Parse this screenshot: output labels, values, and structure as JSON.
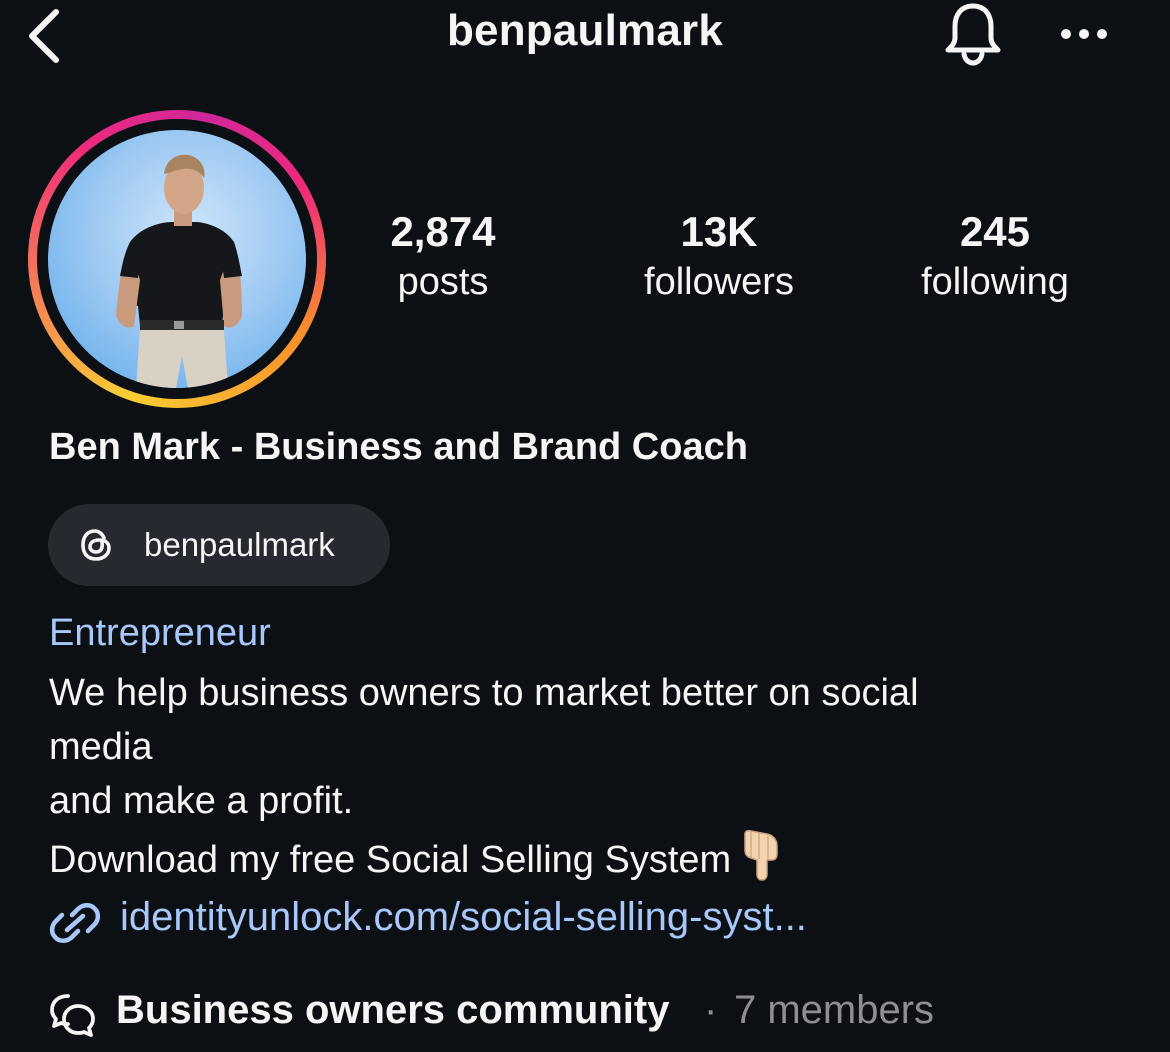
{
  "header": {
    "username": "benpaulmark",
    "icons": {
      "back": "chevron-left-icon",
      "notifications": "bell-icon",
      "more": "more-horizontal-icon"
    }
  },
  "profile": {
    "avatar_icon": "profile-picture",
    "story_ring_colors": [
      "#f9ce34",
      "#ee2a7b",
      "#d0279b",
      "#f98f2c"
    ],
    "stats": {
      "posts": {
        "count": "2,874",
        "label": "posts"
      },
      "followers": {
        "count": "13K",
        "label": "followers"
      },
      "following": {
        "count": "245",
        "label": "following"
      }
    },
    "display_name": "Ben Mark - Business and Brand Coach",
    "threads": {
      "icon": "threads-icon",
      "handle": "benpaulmark"
    },
    "category": "Entrepreneur",
    "bio_lines": [
      "We help business owners to market better on social",
      "media",
      "and make a profit.",
      "Download my free Social Selling System"
    ],
    "bio_emoji": "backhand-index-pointing-down-icon",
    "link": {
      "icon": "link-icon",
      "text": "identityunlock.com/social-selling-syst..."
    },
    "community": {
      "icon": "chat-bubbles-icon",
      "name": "Business owners community",
      "separator": "·",
      "members": "7 members"
    }
  },
  "colors": {
    "background": "#0c1014",
    "text": "#f5f5f5",
    "link": "#a8c7fa",
    "muted": "#8e8e93",
    "pill": "#262a30"
  }
}
